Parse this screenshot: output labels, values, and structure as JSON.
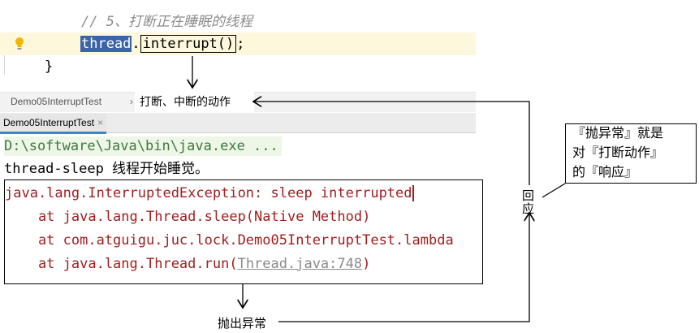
{
  "editor": {
    "comment": "// 5、打断正在睡眠的线程",
    "tok_thread": "thread",
    "tok_dot": ".",
    "tok_interrupt": "interrupt()",
    "tok_semicolon": ";",
    "closing_brace": "}"
  },
  "breadcrumb": {
    "left_text": "Demo05InterruptTest",
    "sep": "›",
    "annotation": "打断、中断的动作"
  },
  "run_tab": {
    "label": "Demo05InterruptTest",
    "close": "×"
  },
  "console": {
    "command": "D:\\software\\Java\\bin\\java.exe ...",
    "line1": "thread-sleep 线程开始睡觉。",
    "exception": "java.lang.InterruptedException: sleep interrupted",
    "stack": [
      "    at java.lang.Thread.sleep(Native Method)",
      "    at com.atguigu.juc.lock.Demo05InterruptTest.lambda",
      "    at java.lang.Thread.run("
    ],
    "stack_link": "Thread.java:748",
    "stack_tail": ")"
  },
  "annotations": {
    "callout_lines": [
      "『抛异常』就是",
      "对『打断动作』",
      "的『响应』"
    ],
    "respond": [
      "回",
      "应"
    ],
    "throw_exception": "抛出异常"
  },
  "icons": {
    "bulb": "lightbulb-icon"
  },
  "colors": {
    "selection": "#3b63a8",
    "error_text": "#a11e1e",
    "current_line": "#fdf8dc",
    "tab_underline": "#4083c9"
  }
}
